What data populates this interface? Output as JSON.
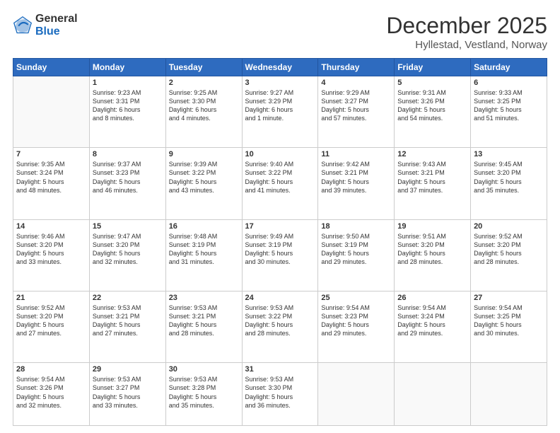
{
  "logo": {
    "general": "General",
    "blue": "Blue"
  },
  "header": {
    "month": "December 2025",
    "location": "Hyllestad, Vestland, Norway"
  },
  "weekdays": [
    "Sunday",
    "Monday",
    "Tuesday",
    "Wednesday",
    "Thursday",
    "Friday",
    "Saturday"
  ],
  "weeks": [
    [
      {
        "num": "",
        "info": ""
      },
      {
        "num": "1",
        "info": "Sunrise: 9:23 AM\nSunset: 3:31 PM\nDaylight: 6 hours\nand 8 minutes."
      },
      {
        "num": "2",
        "info": "Sunrise: 9:25 AM\nSunset: 3:30 PM\nDaylight: 6 hours\nand 4 minutes."
      },
      {
        "num": "3",
        "info": "Sunrise: 9:27 AM\nSunset: 3:29 PM\nDaylight: 6 hours\nand 1 minute."
      },
      {
        "num": "4",
        "info": "Sunrise: 9:29 AM\nSunset: 3:27 PM\nDaylight: 5 hours\nand 57 minutes."
      },
      {
        "num": "5",
        "info": "Sunrise: 9:31 AM\nSunset: 3:26 PM\nDaylight: 5 hours\nand 54 minutes."
      },
      {
        "num": "6",
        "info": "Sunrise: 9:33 AM\nSunset: 3:25 PM\nDaylight: 5 hours\nand 51 minutes."
      }
    ],
    [
      {
        "num": "7",
        "info": "Sunrise: 9:35 AM\nSunset: 3:24 PM\nDaylight: 5 hours\nand 48 minutes."
      },
      {
        "num": "8",
        "info": "Sunrise: 9:37 AM\nSunset: 3:23 PM\nDaylight: 5 hours\nand 46 minutes."
      },
      {
        "num": "9",
        "info": "Sunrise: 9:39 AM\nSunset: 3:22 PM\nDaylight: 5 hours\nand 43 minutes."
      },
      {
        "num": "10",
        "info": "Sunrise: 9:40 AM\nSunset: 3:22 PM\nDaylight: 5 hours\nand 41 minutes."
      },
      {
        "num": "11",
        "info": "Sunrise: 9:42 AM\nSunset: 3:21 PM\nDaylight: 5 hours\nand 39 minutes."
      },
      {
        "num": "12",
        "info": "Sunrise: 9:43 AM\nSunset: 3:21 PM\nDaylight: 5 hours\nand 37 minutes."
      },
      {
        "num": "13",
        "info": "Sunrise: 9:45 AM\nSunset: 3:20 PM\nDaylight: 5 hours\nand 35 minutes."
      }
    ],
    [
      {
        "num": "14",
        "info": "Sunrise: 9:46 AM\nSunset: 3:20 PM\nDaylight: 5 hours\nand 33 minutes."
      },
      {
        "num": "15",
        "info": "Sunrise: 9:47 AM\nSunset: 3:20 PM\nDaylight: 5 hours\nand 32 minutes."
      },
      {
        "num": "16",
        "info": "Sunrise: 9:48 AM\nSunset: 3:19 PM\nDaylight: 5 hours\nand 31 minutes."
      },
      {
        "num": "17",
        "info": "Sunrise: 9:49 AM\nSunset: 3:19 PM\nDaylight: 5 hours\nand 30 minutes."
      },
      {
        "num": "18",
        "info": "Sunrise: 9:50 AM\nSunset: 3:19 PM\nDaylight: 5 hours\nand 29 minutes."
      },
      {
        "num": "19",
        "info": "Sunrise: 9:51 AM\nSunset: 3:20 PM\nDaylight: 5 hours\nand 28 minutes."
      },
      {
        "num": "20",
        "info": "Sunrise: 9:52 AM\nSunset: 3:20 PM\nDaylight: 5 hours\nand 28 minutes."
      }
    ],
    [
      {
        "num": "21",
        "info": "Sunrise: 9:52 AM\nSunset: 3:20 PM\nDaylight: 5 hours\nand 27 minutes."
      },
      {
        "num": "22",
        "info": "Sunrise: 9:53 AM\nSunset: 3:21 PM\nDaylight: 5 hours\nand 27 minutes."
      },
      {
        "num": "23",
        "info": "Sunrise: 9:53 AM\nSunset: 3:21 PM\nDaylight: 5 hours\nand 28 minutes."
      },
      {
        "num": "24",
        "info": "Sunrise: 9:53 AM\nSunset: 3:22 PM\nDaylight: 5 hours\nand 28 minutes."
      },
      {
        "num": "25",
        "info": "Sunrise: 9:54 AM\nSunset: 3:23 PM\nDaylight: 5 hours\nand 29 minutes."
      },
      {
        "num": "26",
        "info": "Sunrise: 9:54 AM\nSunset: 3:24 PM\nDaylight: 5 hours\nand 29 minutes."
      },
      {
        "num": "27",
        "info": "Sunrise: 9:54 AM\nSunset: 3:25 PM\nDaylight: 5 hours\nand 30 minutes."
      }
    ],
    [
      {
        "num": "28",
        "info": "Sunrise: 9:54 AM\nSunset: 3:26 PM\nDaylight: 5 hours\nand 32 minutes."
      },
      {
        "num": "29",
        "info": "Sunrise: 9:53 AM\nSunset: 3:27 PM\nDaylight: 5 hours\nand 33 minutes."
      },
      {
        "num": "30",
        "info": "Sunrise: 9:53 AM\nSunset: 3:28 PM\nDaylight: 5 hours\nand 35 minutes."
      },
      {
        "num": "31",
        "info": "Sunrise: 9:53 AM\nSunset: 3:30 PM\nDaylight: 5 hours\nand 36 minutes."
      },
      {
        "num": "",
        "info": ""
      },
      {
        "num": "",
        "info": ""
      },
      {
        "num": "",
        "info": ""
      }
    ]
  ]
}
